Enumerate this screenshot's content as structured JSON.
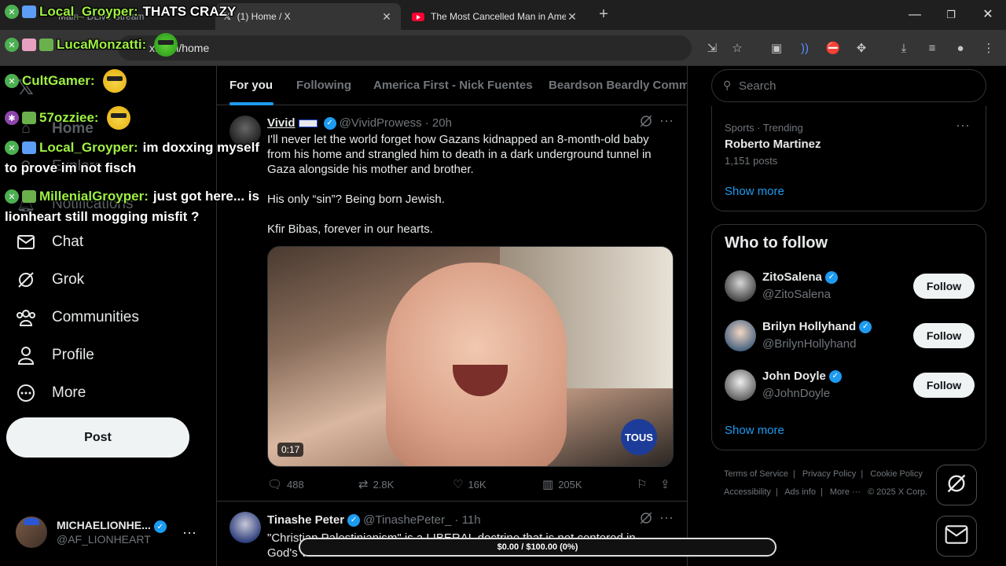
{
  "browser": {
    "tabs": [
      {
        "title": "Main - DLive Stream"
      },
      {
        "title": "(1) Home / X"
      },
      {
        "title": "The Most Cancelled Man in America"
      }
    ],
    "address": "x.com/home"
  },
  "nav": {
    "items": [
      {
        "label": "Home"
      },
      {
        "label": "Explore"
      },
      {
        "label": "Notifications"
      },
      {
        "label": "Chat"
      },
      {
        "label": "Grok"
      },
      {
        "label": "Communities"
      },
      {
        "label": "Profile"
      },
      {
        "label": "More"
      }
    ],
    "post_label": "Post",
    "account": {
      "name": "MICHAELIONHE...",
      "handle": "@AF_LIONHEART"
    }
  },
  "chat_overlay": [
    {
      "user": "Local_Groyper:",
      "message": "THATS CRAZY"
    },
    {
      "user": "LucaMonzatti:",
      "message": ""
    },
    {
      "user": "CultGamer:",
      "message": ""
    },
    {
      "user": "57ozziee:",
      "message": ""
    },
    {
      "user": "Local_Groyper:",
      "message": "im doxxing myself"
    },
    {
      "user": "",
      "message": "to prove im not fisch"
    },
    {
      "user": "MillenialGroyper:",
      "message": "just got here... is"
    },
    {
      "user": "",
      "message": "lionheart still mogging misfit ?"
    }
  ],
  "timeline": {
    "tabs": [
      "For you",
      "Following",
      "America First - Nick Fuentes",
      "Beardson Beardly Commu"
    ],
    "tweets": [
      {
        "name": "Vivid",
        "handle": "@VividProwess",
        "time": "20h",
        "paragraphs": [
          "I'll never let the world forget how Gazans kidnapped an 8-month-old baby from his home and strangled him to death in a dark underground tunnel in Gaza alongside his mother and brother.",
          "His only “sin”? Being born Jewish.",
          "Kfir Bibas, forever in our hearts."
        ],
        "video_duration": "0:17",
        "video_logo": "TOUS",
        "replies": "488",
        "reposts": "2.8K",
        "likes": "16K",
        "views": "205K"
      },
      {
        "name": "Tinashe Peter",
        "handle": "@TinashePeter_",
        "time": "11h",
        "paragraphs": [
          "\"Christian Palestinianism\" is a LIBERAL doctrine that is not centered in God's Word."
        ]
      }
    ]
  },
  "right": {
    "search_placeholder": "Search",
    "trend": {
      "meta": "Sports · Trending",
      "name": "Roberto Martinez",
      "count": "1,151 posts"
    },
    "show_more": "Show more",
    "who_to_follow": "Who to follow",
    "follow_label": "Follow",
    "suggestions": [
      {
        "name": "ZitoSalena",
        "handle": "@ZitoSalena"
      },
      {
        "name": "Brilyn Hollyhand",
        "handle": "@BrilynHollyhand"
      },
      {
        "name": "John Doyle",
        "handle": "@JohnDoyle"
      }
    ],
    "footer": [
      "Terms of Service",
      "Privacy Policy",
      "Cookie Policy",
      "Accessibility",
      "Ads info",
      "More ···",
      "© 2025 X Corp."
    ]
  },
  "donation_goal": {
    "text": "$0.00 / $100.00 (0%)",
    "progress_fraction": 0
  },
  "colors": {
    "accent": "#1d9bf0",
    "background": "#000000",
    "chat_user": "#9ef042"
  }
}
